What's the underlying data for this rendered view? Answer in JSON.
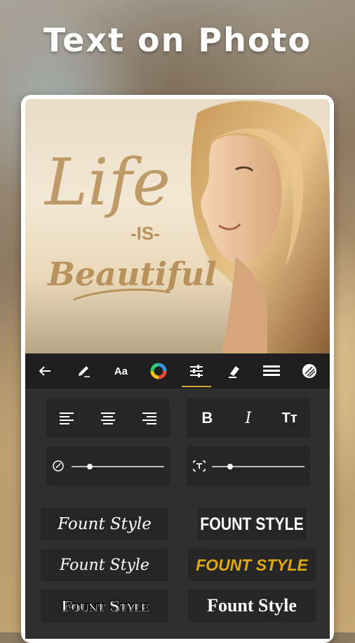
{
  "headline": "Text on Photo",
  "photo": {
    "quote_word1": "Life",
    "quote_word2": "-IS-",
    "quote_word3": "Beautiful"
  },
  "toolbar": {
    "tools": [
      {
        "name": "back",
        "icon": "arrow-left-icon"
      },
      {
        "name": "edit-text",
        "icon": "pencil-icon"
      },
      {
        "name": "font",
        "icon": "font-aa-icon",
        "label": "Aa"
      },
      {
        "name": "color",
        "icon": "color-wheel-icon"
      },
      {
        "name": "adjust",
        "icon": "sliders-icon",
        "active": true
      },
      {
        "name": "highlight",
        "icon": "marker-icon"
      },
      {
        "name": "spacing",
        "icon": "lines-icon"
      },
      {
        "name": "texture",
        "icon": "texture-icon"
      }
    ],
    "active_color": "#d9a93a"
  },
  "format": {
    "bold_label": "B",
    "italic_label": "I",
    "case_label": "Tт"
  },
  "sliders": {
    "curve_level": 0.2,
    "size_level": 0.2
  },
  "font_styles": [
    "Fount Style",
    "FOUNT STYLE",
    "Fount Style",
    "FOUNT STYLE",
    "Fount Style",
    "Fount Style"
  ],
  "accent_gold": "#e0a910"
}
